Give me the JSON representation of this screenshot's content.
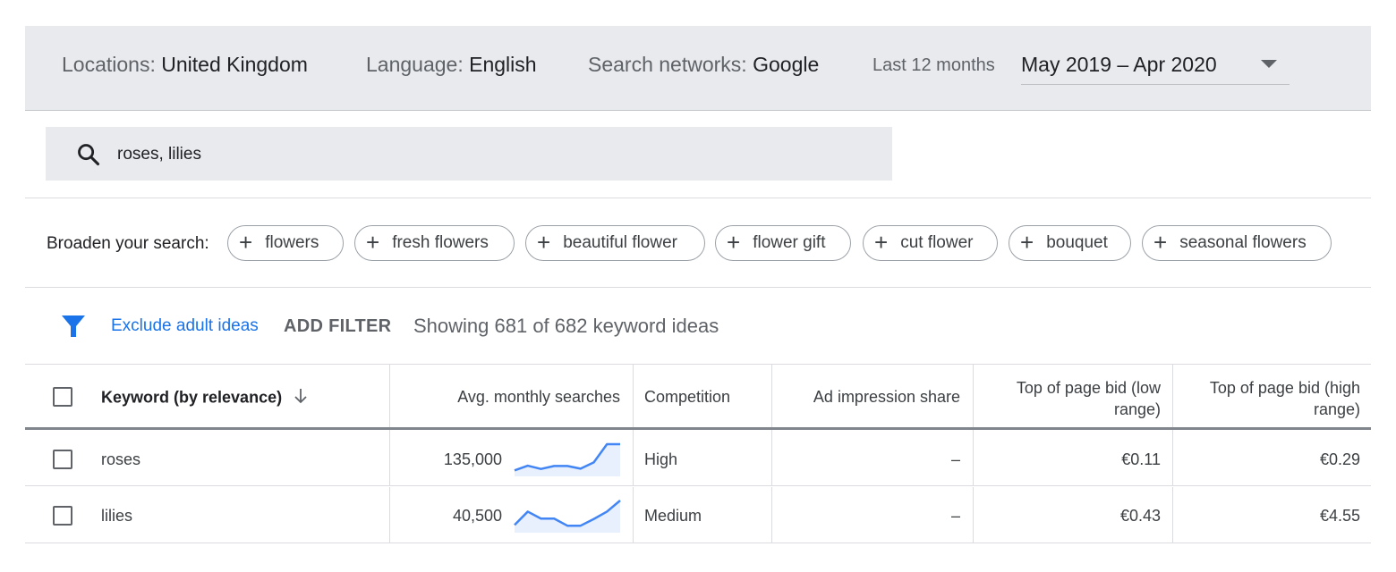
{
  "filters": {
    "locations_label": "Locations:",
    "locations_value": "United Kingdom",
    "language_label": "Language:",
    "language_value": "English",
    "networks_label": "Search networks:",
    "networks_value": "Google",
    "period_label": "Last 12 months",
    "period_value": "May 2019 – Apr 2020"
  },
  "search": {
    "query": "roses, lilies"
  },
  "broaden": {
    "label": "Broaden your search:",
    "chips": [
      "flowers",
      "fresh flowers",
      "beautiful flower",
      "flower gift",
      "cut flower",
      "bouquet",
      "seasonal flowers"
    ]
  },
  "toolbar": {
    "exclude_label": "Exclude adult ideas",
    "add_filter_label": "ADD FILTER",
    "showing_text": "Showing 681 of 682 keyword ideas"
  },
  "table": {
    "headers": {
      "keyword": "Keyword (by relevance)",
      "searches": "Avg. monthly searches",
      "competition": "Competition",
      "impression": "Ad impression share",
      "bid_low_1": "Top of page bid (low",
      "bid_low_2": "range)",
      "bid_high_1": "Top of page bid (high",
      "bid_high_2": "range)"
    },
    "rows": [
      {
        "keyword": "roses",
        "searches": "135,000",
        "trend": [
          28,
          60,
          38,
          58,
          58,
          40,
          82,
          205,
          205
        ],
        "competition": "High",
        "impression": "–",
        "bid_low": "€0.11",
        "bid_high": "€0.29"
      },
      {
        "keyword": "lilies",
        "searches": "40,500",
        "trend": [
          40,
          130,
          83,
          83,
          35,
          35,
          80,
          130,
          205
        ],
        "competition": "Medium",
        "impression": "–",
        "bid_low": "€0.43",
        "bid_high": "€4.55"
      }
    ]
  },
  "colors": {
    "accent": "#1a73e8",
    "sparkline_line": "#4285f4",
    "sparkline_fill": "#e8f0fe"
  }
}
